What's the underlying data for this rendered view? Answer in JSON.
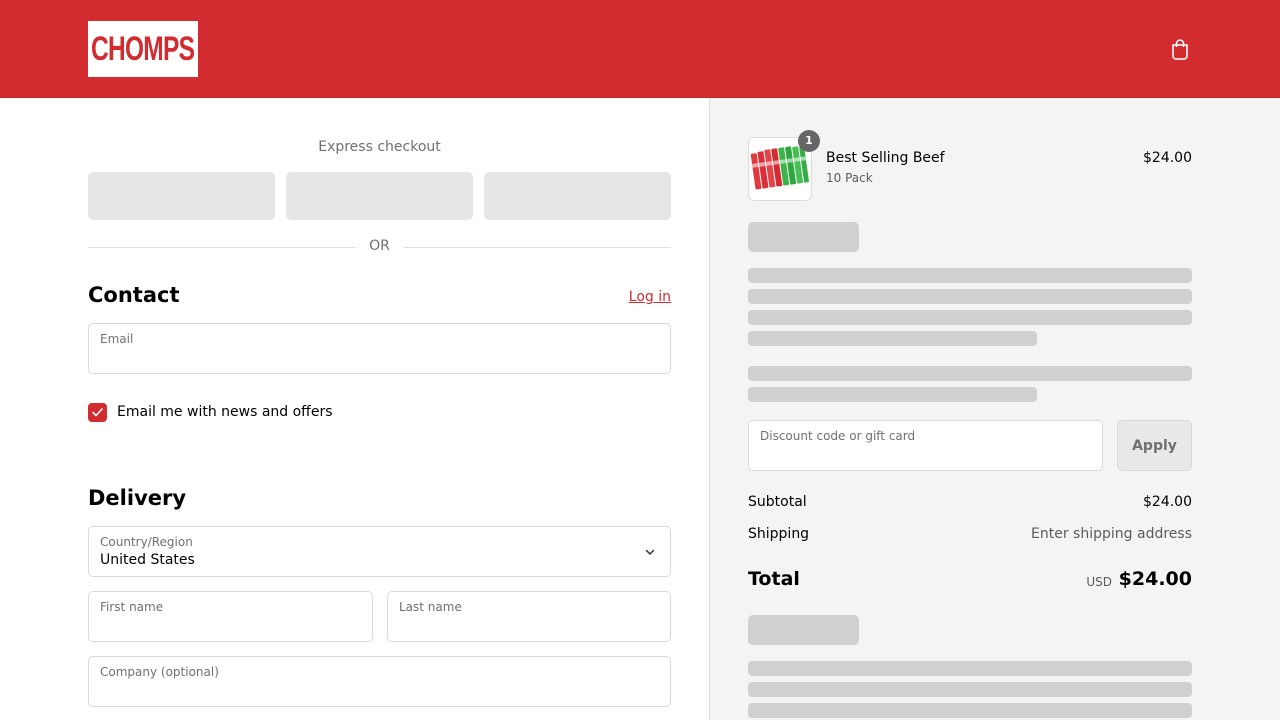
{
  "header": {
    "logo_text": "CHOMPS",
    "brand_color": "#d22b30",
    "cart_icon": "shopping-bag-icon"
  },
  "express": {
    "title": "Express checkout",
    "divider": "OR"
  },
  "contact": {
    "title": "Contact",
    "login_label": "Log in",
    "email": {
      "label": "Email",
      "value": ""
    },
    "newsletter": {
      "label": "Email me with news and offers",
      "checked": true
    }
  },
  "delivery": {
    "title": "Delivery",
    "country": {
      "label": "Country/Region",
      "value": "United States"
    },
    "first_name": {
      "label": "First name",
      "value": ""
    },
    "last_name": {
      "label": "Last name",
      "value": ""
    },
    "company": {
      "label": "Company (optional)",
      "value": ""
    }
  },
  "order": {
    "product": {
      "name": "Best Selling Beef",
      "variant": "10 Pack",
      "price": "$24.00",
      "quantity": "1"
    },
    "discount": {
      "label": "Discount code or gift card",
      "apply_label": "Apply"
    },
    "subtotal": {
      "label": "Subtotal",
      "value": "$24.00"
    },
    "shipping": {
      "label": "Shipping",
      "value": "Enter shipping address"
    },
    "total": {
      "label": "Total",
      "currency": "USD",
      "value": "$24.00"
    }
  }
}
